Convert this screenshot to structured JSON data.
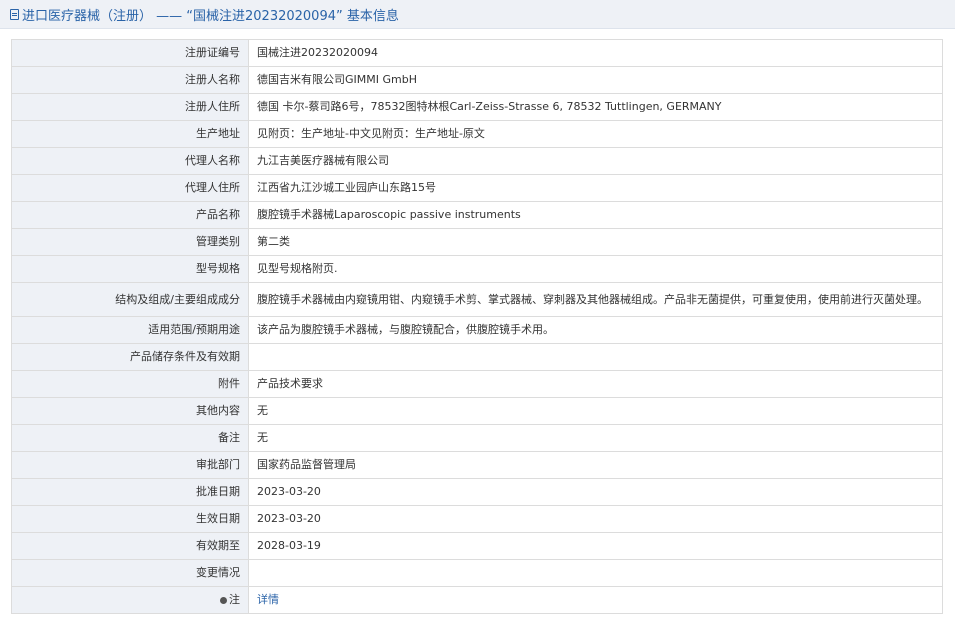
{
  "header": {
    "title": "进口医疗器械（注册） —— “国械注进20232020094” 基本信息"
  },
  "rows": [
    {
      "label": "注册证编号",
      "value": "国械注进20232020094"
    },
    {
      "label": "注册人名称",
      "value": "德国吉米有限公司GIMMI GmbH"
    },
    {
      "label": "注册人住所",
      "value": "德国 卡尔-蔡司路6号，78532图特林根Carl-Zeiss-Strasse 6, 78532 Tuttlingen, GERMANY"
    },
    {
      "label": "生产地址",
      "value": "见附页：生产地址-中文见附页：生产地址-原文"
    },
    {
      "label": "代理人名称",
      "value": "九江吉美医疗器械有限公司"
    },
    {
      "label": "代理人住所",
      "value": "江西省九江沙城工业园庐山东路15号"
    },
    {
      "label": "产品名称",
      "value": "腹腔镜手术器械Laparoscopic passive instruments"
    },
    {
      "label": "管理类别",
      "value": "第二类"
    },
    {
      "label": "型号规格",
      "value": "见型号规格附页."
    },
    {
      "label": "结构及组成/主要组成成分",
      "value": "腹腔镜手术器械由内窥镜用钳、内窥镜手术剪、掌式器械、穿刺器及其他器械组成。产品非无菌提供，可重复使用，使用前进行灭菌处理。"
    },
    {
      "label": "适用范围/预期用途",
      "value": "该产品为腹腔镜手术器械，与腹腔镜配合，供腹腔镜手术用。"
    },
    {
      "label": "产品储存条件及有效期",
      "value": ""
    },
    {
      "label": "附件",
      "value": "产品技术要求"
    },
    {
      "label": "其他内容",
      "value": "无"
    },
    {
      "label": "备注",
      "value": "无"
    },
    {
      "label": "审批部门",
      "value": "国家药品监督管理局"
    },
    {
      "label": "批准日期",
      "value": "2023-03-20"
    },
    {
      "label": "生效日期",
      "value": "2023-03-20"
    },
    {
      "label": "有效期至",
      "value": "2028-03-19"
    },
    {
      "label": "变更情况",
      "value": ""
    }
  ],
  "note_row": {
    "label": "注",
    "link": "详情",
    "icon": "note-icon"
  },
  "colors": {
    "label_bg": "#eef1f6",
    "link": "#2a63a8",
    "border": "#dcdcdc"
  }
}
